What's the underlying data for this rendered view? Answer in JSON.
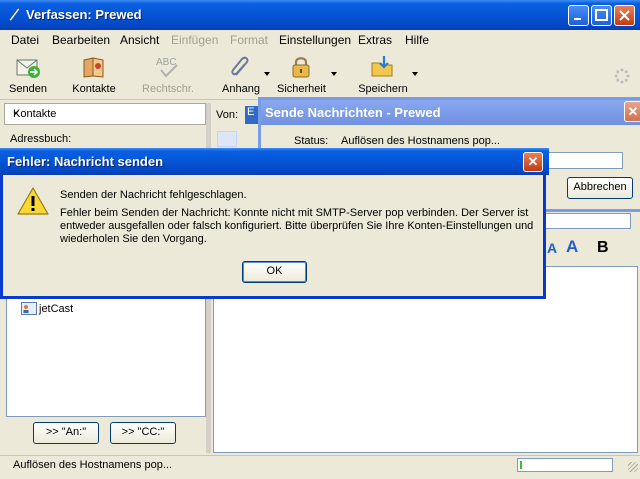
{
  "window": {
    "title": "Verfassen: Prewed"
  },
  "menu": [
    "Datei",
    "Bearbeiten",
    "Ansicht",
    "Einfügen",
    "Format",
    "Einstellungen",
    "Extras",
    "Hilfe"
  ],
  "toolbar": {
    "send": "Senden",
    "contacts": "Kontakte",
    "spellcheck": "Rechtschr.",
    "attach": "Anhang",
    "security": "Sicherheit",
    "save": "Speichern"
  },
  "sidebar": {
    "title": "Kontakte",
    "addressbook_label": "Adressbuch:",
    "contacts": [
      "jetCast"
    ],
    "to_button": ">> \"An:\"",
    "cc_button": ">> \"CC:\""
  },
  "compose": {
    "from_label": "Von:",
    "from_value": "E"
  },
  "format": {
    "a_small": "A",
    "a_large": "A",
    "bold": "B"
  },
  "statusbar": {
    "text": "Auflösen des Hostnamens pop...",
    "progress": 0.02
  },
  "send_dialog": {
    "title": "Sende Nachrichten - Prewed",
    "status_label": "Status:",
    "status_value": "Auflösen des Hostnamens pop...",
    "cancel": "Abbrechen"
  },
  "error_dialog": {
    "title": "Fehler: Nachricht senden",
    "summary": "Senden der Nachricht fehlgeschlagen.",
    "detail": "Fehler beim Senden der Nachricht: Konnte nicht mit SMTP-Server pop verbinden. Der Server ist entweder ausgefallen oder falsch konfiguriert. Bitte überprüfen Sie Ihre Konten-Einstellungen und wiederholen Sie den Vorgang.",
    "ok": "OK"
  }
}
